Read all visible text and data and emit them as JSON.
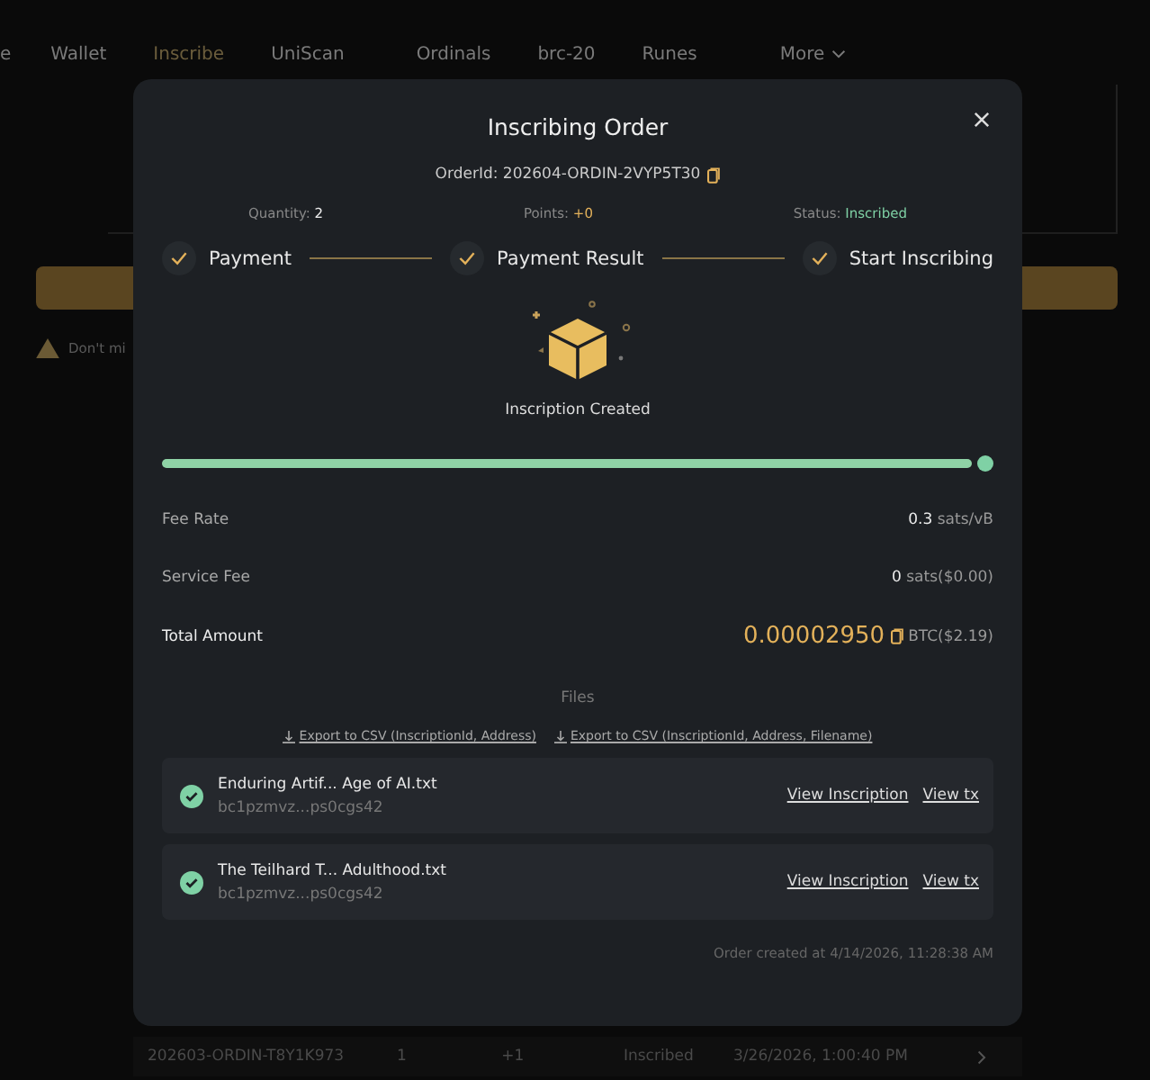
{
  "nav": {
    "items": [
      {
        "label": "e",
        "selected": false
      },
      {
        "label": "Wallet",
        "selected": false
      },
      {
        "label": "Inscribe",
        "selected": true
      },
      {
        "label": "UniScan",
        "selected": false
      },
      {
        "label": "Ordinals",
        "selected": false
      },
      {
        "label": "brc-20",
        "selected": false
      },
      {
        "label": "Runes",
        "selected": false
      },
      {
        "label": "More",
        "selected": false
      }
    ]
  },
  "background": {
    "warning": "Don't mi",
    "order_row": [
      "202603-ORDIN-T8Y1K973",
      "1",
      "+1",
      "Inscribed",
      "3/26/2026, 1:00:40 PM"
    ]
  },
  "modal": {
    "title": "Inscribing Order",
    "order_id_label": "OrderId:",
    "order_id": "202604-ORDIN-2VYP5T30",
    "stats": [
      {
        "label": "Quantity:",
        "value": "2",
        "kind": "plain"
      },
      {
        "label": "Points:",
        "value": "+0",
        "kind": "points"
      },
      {
        "label": "Status:",
        "value": "Inscribed",
        "kind": "status"
      }
    ],
    "steps": [
      {
        "label": "Payment",
        "done": true
      },
      {
        "label": "Payment Result",
        "done": true
      },
      {
        "label": "Start Inscribing",
        "done": true
      }
    ],
    "result": "Inscription Created",
    "progress": {
      "level": 1,
      "complete": true
    },
    "fees": [
      {
        "label": "Fee Rate",
        "value": "0.3",
        "unit": "sats/vB"
      },
      {
        "label": "Service Fee",
        "value": "0",
        "unit": "sats($0.00)"
      }
    ],
    "total": {
      "label": "Total Amount",
      "value": "0.00002950",
      "unit": "BTC($2.19)"
    },
    "files_heading": "Files",
    "exports": [
      "Export to CSV (InscriptionId, Address)",
      "Export to CSV (InscriptionId, Address, Filename)"
    ],
    "files": [
      {
        "name": "Enduring Artif... Age of AI.txt",
        "address": "bc1pzmvz...ps0cgs42",
        "done": true,
        "links": [
          "View Inscription",
          "View tx"
        ]
      },
      {
        "name": "The Teilhard T... Adulthood.txt",
        "address": "bc1pzmvz...ps0cgs42",
        "done": true,
        "links": [
          "View Inscription",
          "View tx"
        ]
      }
    ],
    "created_at": "Order created at 4/14/2026, 11:28:38 AM"
  }
}
